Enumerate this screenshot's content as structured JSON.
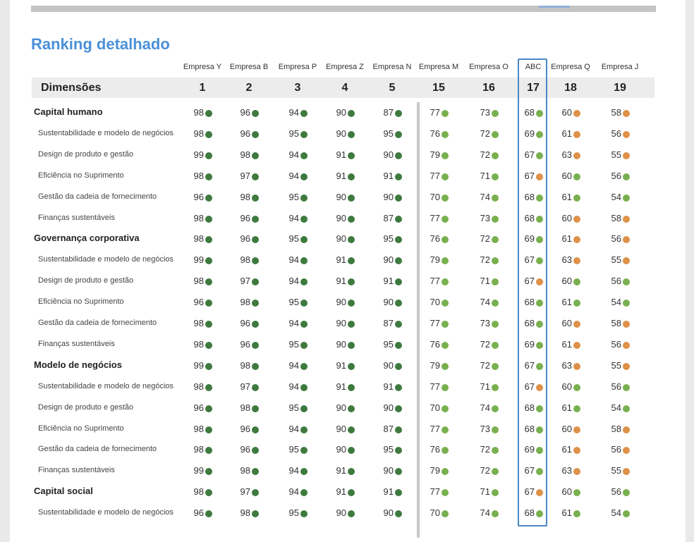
{
  "title": "Ranking detalhado",
  "colors": {
    "dark_green": "#3e7a3f",
    "light_green": "#79b04f",
    "orange": "#de9149",
    "highlight_border": "#4b87c5"
  },
  "header": {
    "label": "Dimensões",
    "columns": [
      {
        "name": "Empresa Y",
        "rank": "1"
      },
      {
        "name": "Empresa B",
        "rank": "2"
      },
      {
        "name": "Empresa P",
        "rank": "3"
      },
      {
        "name": "Empresa Z",
        "rank": "4"
      },
      {
        "name": "Empresa N",
        "rank": "5"
      },
      {
        "name": "Empresa M",
        "rank": "15"
      },
      {
        "name": "Empresa O",
        "rank": "16"
      },
      {
        "name": "ABC",
        "rank": "17",
        "highlighted": true
      },
      {
        "name": "Empresa Q",
        "rank": "18"
      },
      {
        "name": "Empresa J",
        "rank": "19"
      }
    ]
  },
  "rows": [
    {
      "label": "Capital humano",
      "type": "category",
      "values": [
        [
          "98",
          "dark_green"
        ],
        [
          "96",
          "dark_green"
        ],
        [
          "94",
          "dark_green"
        ],
        [
          "90",
          "dark_green"
        ],
        [
          "87",
          "dark_green"
        ],
        [
          "77",
          "light_green"
        ],
        [
          "73",
          "light_green"
        ],
        [
          "68",
          "light_green"
        ],
        [
          "60",
          "orange"
        ],
        [
          "58",
          "orange"
        ]
      ]
    },
    {
      "label": "Sustentabilidade e modelo de negócios",
      "type": "sub",
      "values": [
        [
          "98",
          "dark_green"
        ],
        [
          "96",
          "dark_green"
        ],
        [
          "95",
          "dark_green"
        ],
        [
          "90",
          "dark_green"
        ],
        [
          "95",
          "dark_green"
        ],
        [
          "76",
          "light_green"
        ],
        [
          "72",
          "light_green"
        ],
        [
          "69",
          "light_green"
        ],
        [
          "61",
          "orange"
        ],
        [
          "56",
          "orange"
        ]
      ]
    },
    {
      "label": "Design de produto e gestão",
      "type": "sub",
      "values": [
        [
          "99",
          "dark_green"
        ],
        [
          "98",
          "dark_green"
        ],
        [
          "94",
          "dark_green"
        ],
        [
          "91",
          "dark_green"
        ],
        [
          "90",
          "dark_green"
        ],
        [
          "79",
          "light_green"
        ],
        [
          "72",
          "light_green"
        ],
        [
          "67",
          "light_green"
        ],
        [
          "63",
          "orange"
        ],
        [
          "55",
          "orange"
        ]
      ]
    },
    {
      "label": "Eficiência no Suprimento",
      "type": "sub",
      "values": [
        [
          "98",
          "dark_green"
        ],
        [
          "97",
          "dark_green"
        ],
        [
          "94",
          "dark_green"
        ],
        [
          "91",
          "dark_green"
        ],
        [
          "91",
          "dark_green"
        ],
        [
          "77",
          "light_green"
        ],
        [
          "71",
          "light_green"
        ],
        [
          "67",
          "orange"
        ],
        [
          "60",
          "light_green"
        ],
        [
          "56",
          "light_green"
        ]
      ]
    },
    {
      "label": "Gestão da cadeia de fornecimento",
      "type": "sub",
      "values": [
        [
          "96",
          "dark_green"
        ],
        [
          "98",
          "dark_green"
        ],
        [
          "95",
          "dark_green"
        ],
        [
          "90",
          "dark_green"
        ],
        [
          "90",
          "dark_green"
        ],
        [
          "70",
          "light_green"
        ],
        [
          "74",
          "light_green"
        ],
        [
          "68",
          "light_green"
        ],
        [
          "61",
          "light_green"
        ],
        [
          "54",
          "light_green"
        ]
      ]
    },
    {
      "label": "Finanças sustentáveis",
      "type": "sub",
      "values": [
        [
          "98",
          "dark_green"
        ],
        [
          "96",
          "dark_green"
        ],
        [
          "94",
          "dark_green"
        ],
        [
          "90",
          "dark_green"
        ],
        [
          "87",
          "dark_green"
        ],
        [
          "77",
          "light_green"
        ],
        [
          "73",
          "light_green"
        ],
        [
          "68",
          "light_green"
        ],
        [
          "60",
          "orange"
        ],
        [
          "58",
          "orange"
        ]
      ]
    },
    {
      "label": "Governança corporativa",
      "type": "category",
      "values": [
        [
          "98",
          "dark_green"
        ],
        [
          "96",
          "dark_green"
        ],
        [
          "95",
          "dark_green"
        ],
        [
          "90",
          "dark_green"
        ],
        [
          "95",
          "dark_green"
        ],
        [
          "76",
          "light_green"
        ],
        [
          "72",
          "light_green"
        ],
        [
          "69",
          "light_green"
        ],
        [
          "61",
          "orange"
        ],
        [
          "56",
          "orange"
        ]
      ]
    },
    {
      "label": "Sustentabilidade e modelo de negócios",
      "type": "sub",
      "values": [
        [
          "99",
          "dark_green"
        ],
        [
          "98",
          "dark_green"
        ],
        [
          "94",
          "dark_green"
        ],
        [
          "91",
          "dark_green"
        ],
        [
          "90",
          "dark_green"
        ],
        [
          "79",
          "light_green"
        ],
        [
          "72",
          "light_green"
        ],
        [
          "67",
          "light_green"
        ],
        [
          "63",
          "orange"
        ],
        [
          "55",
          "orange"
        ]
      ]
    },
    {
      "label": "Design de produto e gestão",
      "type": "sub",
      "values": [
        [
          "98",
          "dark_green"
        ],
        [
          "97",
          "dark_green"
        ],
        [
          "94",
          "dark_green"
        ],
        [
          "91",
          "dark_green"
        ],
        [
          "91",
          "dark_green"
        ],
        [
          "77",
          "light_green"
        ],
        [
          "71",
          "light_green"
        ],
        [
          "67",
          "orange"
        ],
        [
          "60",
          "light_green"
        ],
        [
          "56",
          "light_green"
        ]
      ]
    },
    {
      "label": "Eficiência no Suprimento",
      "type": "sub",
      "values": [
        [
          "96",
          "dark_green"
        ],
        [
          "98",
          "dark_green"
        ],
        [
          "95",
          "dark_green"
        ],
        [
          "90",
          "dark_green"
        ],
        [
          "90",
          "dark_green"
        ],
        [
          "70",
          "light_green"
        ],
        [
          "74",
          "light_green"
        ],
        [
          "68",
          "light_green"
        ],
        [
          "61",
          "light_green"
        ],
        [
          "54",
          "light_green"
        ]
      ]
    },
    {
      "label": "Gestão da cadeia de fornecimento",
      "type": "sub",
      "values": [
        [
          "98",
          "dark_green"
        ],
        [
          "96",
          "dark_green"
        ],
        [
          "94",
          "dark_green"
        ],
        [
          "90",
          "dark_green"
        ],
        [
          "87",
          "dark_green"
        ],
        [
          "77",
          "light_green"
        ],
        [
          "73",
          "light_green"
        ],
        [
          "68",
          "light_green"
        ],
        [
          "60",
          "orange"
        ],
        [
          "58",
          "orange"
        ]
      ]
    },
    {
      "label": "Finanças sustentáveis",
      "type": "sub",
      "values": [
        [
          "98",
          "dark_green"
        ],
        [
          "96",
          "dark_green"
        ],
        [
          "95",
          "dark_green"
        ],
        [
          "90",
          "dark_green"
        ],
        [
          "95",
          "dark_green"
        ],
        [
          "76",
          "light_green"
        ],
        [
          "72",
          "light_green"
        ],
        [
          "69",
          "light_green"
        ],
        [
          "61",
          "orange"
        ],
        [
          "56",
          "orange"
        ]
      ]
    },
    {
      "label": "Modelo de negócios",
      "type": "category",
      "values": [
        [
          "99",
          "dark_green"
        ],
        [
          "98",
          "dark_green"
        ],
        [
          "94",
          "dark_green"
        ],
        [
          "91",
          "dark_green"
        ],
        [
          "90",
          "dark_green"
        ],
        [
          "79",
          "light_green"
        ],
        [
          "72",
          "light_green"
        ],
        [
          "67",
          "light_green"
        ],
        [
          "63",
          "orange"
        ],
        [
          "55",
          "orange"
        ]
      ]
    },
    {
      "label": "Sustentabilidade e modelo de negócios",
      "type": "sub",
      "values": [
        [
          "98",
          "dark_green"
        ],
        [
          "97",
          "dark_green"
        ],
        [
          "94",
          "dark_green"
        ],
        [
          "91",
          "dark_green"
        ],
        [
          "91",
          "dark_green"
        ],
        [
          "77",
          "light_green"
        ],
        [
          "71",
          "light_green"
        ],
        [
          "67",
          "orange"
        ],
        [
          "60",
          "light_green"
        ],
        [
          "56",
          "light_green"
        ]
      ]
    },
    {
      "label": "Design de produto e gestão",
      "type": "sub",
      "values": [
        [
          "96",
          "dark_green"
        ],
        [
          "98",
          "dark_green"
        ],
        [
          "95",
          "dark_green"
        ],
        [
          "90",
          "dark_green"
        ],
        [
          "90",
          "dark_green"
        ],
        [
          "70",
          "light_green"
        ],
        [
          "74",
          "light_green"
        ],
        [
          "68",
          "light_green"
        ],
        [
          "61",
          "light_green"
        ],
        [
          "54",
          "light_green"
        ]
      ]
    },
    {
      "label": "Eficiência no Suprimento",
      "type": "sub",
      "values": [
        [
          "98",
          "dark_green"
        ],
        [
          "96",
          "dark_green"
        ],
        [
          "94",
          "dark_green"
        ],
        [
          "90",
          "dark_green"
        ],
        [
          "87",
          "dark_green"
        ],
        [
          "77",
          "light_green"
        ],
        [
          "73",
          "light_green"
        ],
        [
          "68",
          "light_green"
        ],
        [
          "60",
          "orange"
        ],
        [
          "58",
          "orange"
        ]
      ]
    },
    {
      "label": "Gestão da cadeia de fornecimento",
      "type": "sub",
      "values": [
        [
          "98",
          "dark_green"
        ],
        [
          "96",
          "dark_green"
        ],
        [
          "95",
          "dark_green"
        ],
        [
          "90",
          "dark_green"
        ],
        [
          "95",
          "dark_green"
        ],
        [
          "76",
          "light_green"
        ],
        [
          "72",
          "light_green"
        ],
        [
          "69",
          "light_green"
        ],
        [
          "61",
          "orange"
        ],
        [
          "56",
          "orange"
        ]
      ]
    },
    {
      "label": "Finanças sustentáveis",
      "type": "sub",
      "values": [
        [
          "99",
          "dark_green"
        ],
        [
          "98",
          "dark_green"
        ],
        [
          "94",
          "dark_green"
        ],
        [
          "91",
          "dark_green"
        ],
        [
          "90",
          "dark_green"
        ],
        [
          "79",
          "light_green"
        ],
        [
          "72",
          "light_green"
        ],
        [
          "67",
          "light_green"
        ],
        [
          "63",
          "orange"
        ],
        [
          "55",
          "orange"
        ]
      ]
    },
    {
      "label": "Capital social",
      "type": "category",
      "values": [
        [
          "98",
          "dark_green"
        ],
        [
          "97",
          "dark_green"
        ],
        [
          "94",
          "dark_green"
        ],
        [
          "91",
          "dark_green"
        ],
        [
          "91",
          "dark_green"
        ],
        [
          "77",
          "light_green"
        ],
        [
          "71",
          "light_green"
        ],
        [
          "67",
          "orange"
        ],
        [
          "60",
          "light_green"
        ],
        [
          "56",
          "light_green"
        ]
      ]
    },
    {
      "label": "Sustentabilidade e modelo de negócios",
      "type": "sub",
      "values": [
        [
          "96",
          "dark_green"
        ],
        [
          "98",
          "dark_green"
        ],
        [
          "95",
          "dark_green"
        ],
        [
          "90",
          "dark_green"
        ],
        [
          "90",
          "dark_green"
        ],
        [
          "70",
          "light_green"
        ],
        [
          "74",
          "light_green"
        ],
        [
          "68",
          "light_green"
        ],
        [
          "61",
          "light_green"
        ],
        [
          "54",
          "light_green"
        ]
      ]
    }
  ]
}
